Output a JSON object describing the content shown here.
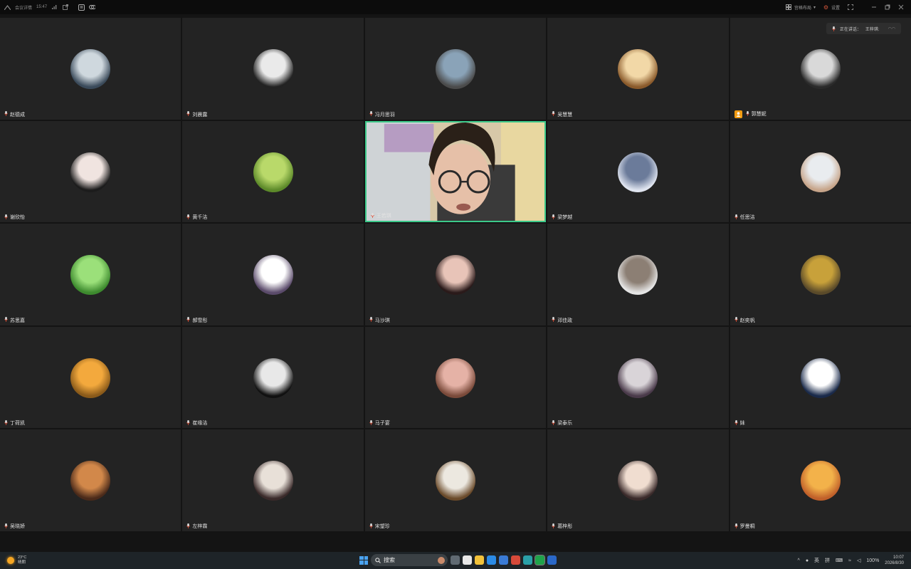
{
  "titlebar": {
    "app_name": "会议详情",
    "time": "15:47",
    "right_buttons": [
      {
        "label": "宫格布局",
        "icon": "grid-icon"
      },
      {
        "label": "设置",
        "icon": "gear-icon"
      }
    ]
  },
  "speaker_indicator": {
    "label": "正在讲话：",
    "speaker": "王梓琪:"
  },
  "participants": [
    {
      "name": "赵德成",
      "avatar_colors": [
        "#cfd8de",
        "#3a4a5a"
      ]
    },
    {
      "name": "刘晨露",
      "avatar_colors": [
        "#eaeaea",
        "#222222"
      ]
    },
    {
      "name": "冯月思羽",
      "avatar_colors": [
        "#8aa3b8",
        "#4b4b4b"
      ]
    },
    {
      "name": "吴慧慧",
      "avatar_colors": [
        "#f2d8a7",
        "#8a5a2b"
      ]
    },
    {
      "name": "郭慧妮",
      "avatar_colors": [
        "#d9d9d9",
        "#2a2a2a"
      ],
      "host": true
    },
    {
      "name": "谢欣怡",
      "avatar_colors": [
        "#f0e4e0",
        "#1c1c1c"
      ]
    },
    {
      "name": "黄千洁",
      "avatar_colors": [
        "#b9d96a",
        "#5d8a2a"
      ]
    },
    {
      "name": "王若琪",
      "video": true
    },
    {
      "name": "梁梦越",
      "avatar_colors": [
        "#6b7b9a",
        "#dfe4ef"
      ]
    },
    {
      "name": "任思洁",
      "avatar_colors": [
        "#e9ecef",
        "#c7a58a"
      ]
    },
    {
      "name": "苏思嘉",
      "avatar_colors": [
        "#9be07a",
        "#3d8a2e"
      ]
    },
    {
      "name": "郝雪彤",
      "avatar_colors": [
        "#ffffff",
        "#5a4a6a"
      ]
    },
    {
      "name": "马沙琪",
      "avatar_colors": [
        "#e8c4b8",
        "#2a1a1a"
      ]
    },
    {
      "name": "邓佳政",
      "avatar_colors": [
        "#8c7f74",
        "#e5e5e5"
      ]
    },
    {
      "name": "赵奕帆",
      "avatar_colors": [
        "#c8a13a",
        "#5a4a2a"
      ]
    },
    {
      "name": "丁荷凯",
      "avatar_colors": [
        "#f3a93d",
        "#8a5a1a"
      ]
    },
    {
      "name": "崔缘洁",
      "avatar_colors": [
        "#e8e8e8",
        "#111111"
      ]
    },
    {
      "name": "马子宴",
      "avatar_colors": [
        "#e5b2a6",
        "#7a4a3a"
      ]
    },
    {
      "name": "梁泰乐",
      "avatar_colors": [
        "#d9d4d8",
        "#4a3a4a"
      ]
    },
    {
      "name": "妹",
      "avatar_colors": [
        "#ffffff",
        "#1a2a4a"
      ]
    },
    {
      "name": "吴晓娇",
      "avatar_colors": [
        "#d2884a",
        "#4a2a1a"
      ]
    },
    {
      "name": "左梓霖",
      "avatar_colors": [
        "#e8e0d8",
        "#3a2a2a"
      ]
    },
    {
      "name": "宋望珍",
      "avatar_colors": [
        "#ece8e0",
        "#6a4a2a"
      ]
    },
    {
      "name": "葛梓彤",
      "avatar_colors": [
        "#f0ddd0",
        "#3a2a2a"
      ]
    },
    {
      "name": "罗曼桐",
      "avatar_colors": [
        "#f3b24a",
        "#c0602a"
      ]
    }
  ],
  "taskbar": {
    "weather_temp": "23°C",
    "weather_desc": "晴朗",
    "search_placeholder": "搜索",
    "tray_lang1": "英",
    "tray_lang2": "拼",
    "battery": "100%",
    "time": "10:07",
    "date": "2026/8/30"
  },
  "colors": {
    "active_border": "#3cc98a",
    "host_badge": "#f39c12",
    "tile_bg": "#232323"
  }
}
